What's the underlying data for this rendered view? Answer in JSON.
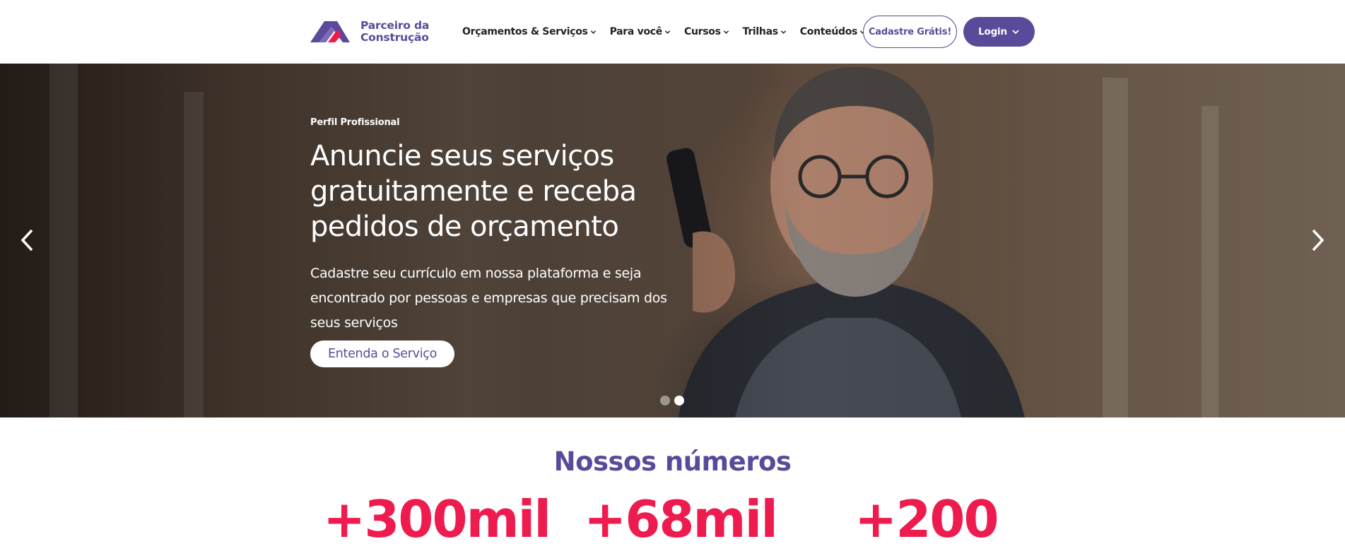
{
  "brand": {
    "name_line1": "Parceiro da",
    "name_line2": "Construção",
    "colors": {
      "primary": "#5b4a9a",
      "accent": "#ee1c4e"
    }
  },
  "nav": {
    "items": [
      {
        "label": "Orçamentos & Serviços",
        "icon": "chevron-down-icon"
      },
      {
        "label": "Para você",
        "icon": "chevron-down-icon"
      },
      {
        "label": "Cursos",
        "icon": "chevron-down-icon"
      },
      {
        "label": "Trilhas",
        "icon": "chevron-down-icon"
      },
      {
        "label": "Conteúdos",
        "icon": "chevron-down-icon"
      }
    ],
    "signup_label": "Cadastre Grátis!",
    "login_label": "Login"
  },
  "hero": {
    "eyebrow": "Perfil Profissional",
    "title": "Anuncie seus serviços gratuitamente e receba pedidos de orçamento",
    "subtitle": "Cadastre seu currículo em nossa plataforma e seja encontrado por pessoas e empresas que precisam dos seus serviços",
    "cta_label": "Entenda o Serviço",
    "slides_total": 2,
    "active_slide": 2
  },
  "numbers": {
    "title": "Nossos números",
    "stats": [
      "+300mil",
      "+68mil",
      "+200"
    ]
  }
}
